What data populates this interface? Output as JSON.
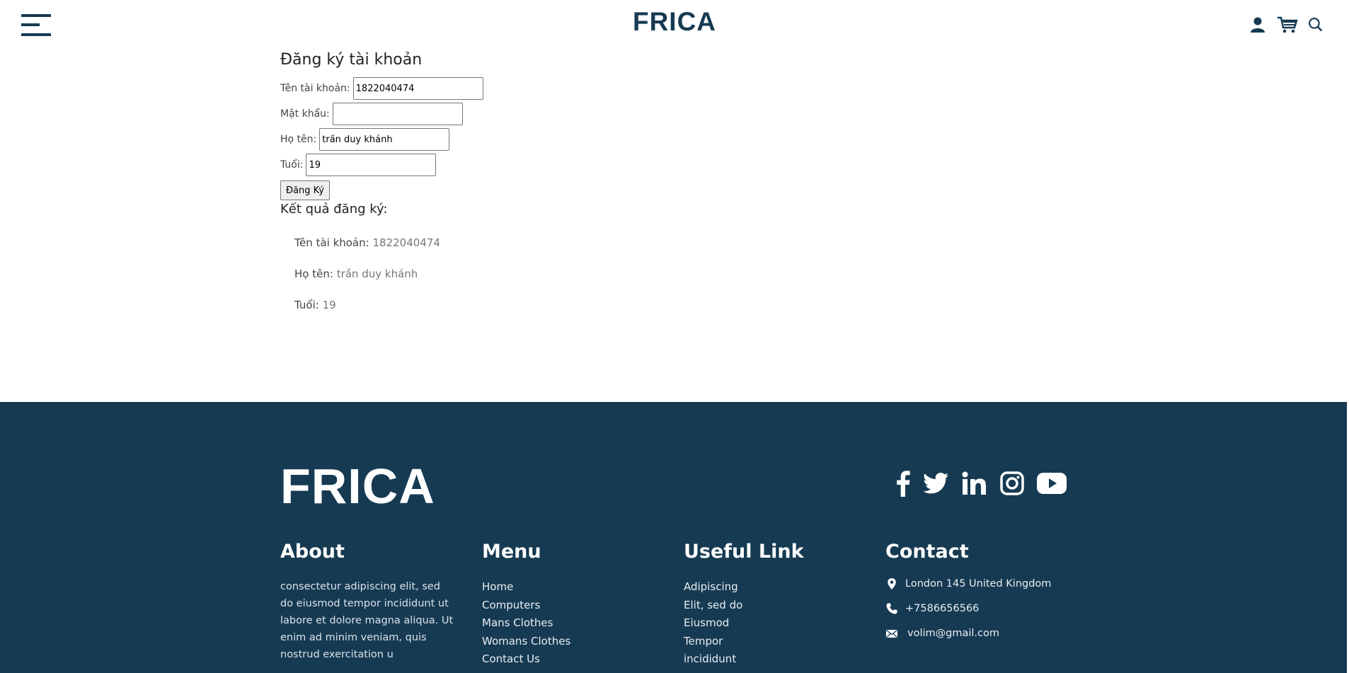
{
  "header": {
    "brand": "FRICA",
    "icons": [
      "user-icon",
      "cart-icon",
      "search-icon"
    ]
  },
  "form": {
    "title": "Đăng ký tài khoản",
    "username_label": "Tên tài khoản:",
    "username_value": "1822040474",
    "password_label": "Mật khẩu:",
    "password_value": "",
    "fullname_label": "Họ tên:",
    "fullname_value": "trần duy khánh",
    "age_label": "Tuổi:",
    "age_value": "19",
    "submit_label": "Đăng Ký"
  },
  "result": {
    "title": "Kết quả đăng ký:",
    "items": [
      {
        "label": "Tên tài khoản:",
        "value": "1822040474"
      },
      {
        "label": "Họ tên:",
        "value": "trần duy khánh"
      },
      {
        "label": "Tuổi:",
        "value": "19"
      }
    ]
  },
  "footer": {
    "brand": "FRICA",
    "social_icons": [
      "facebook-icon",
      "twitter-icon",
      "linkedin-icon",
      "instagram-icon",
      "youtube-icon"
    ],
    "about": {
      "heading": "About",
      "text": "consectetur adipiscing elit, sed do eiusmod tempor incididunt ut labore et dolore magna aliqua. Ut enim ad minim veniam, quis nostrud exercitation u"
    },
    "menu": {
      "heading": "Menu",
      "items": [
        "Home",
        "Computers",
        "Mans Clothes",
        "Womans Clothes",
        "Contact Us"
      ]
    },
    "useful": {
      "heading": "Useful Link",
      "items": [
        "Adipiscing",
        "Elit, sed do",
        "Eiusmod",
        "Tempor",
        "incididunt"
      ]
    },
    "contact": {
      "heading": "Contact",
      "address": "London 145 United Kingdom",
      "phone": "+7586656566",
      "email": "volim@gmail.com"
    }
  },
  "colors": {
    "primary": "#163a52",
    "white": "#ffffff"
  }
}
